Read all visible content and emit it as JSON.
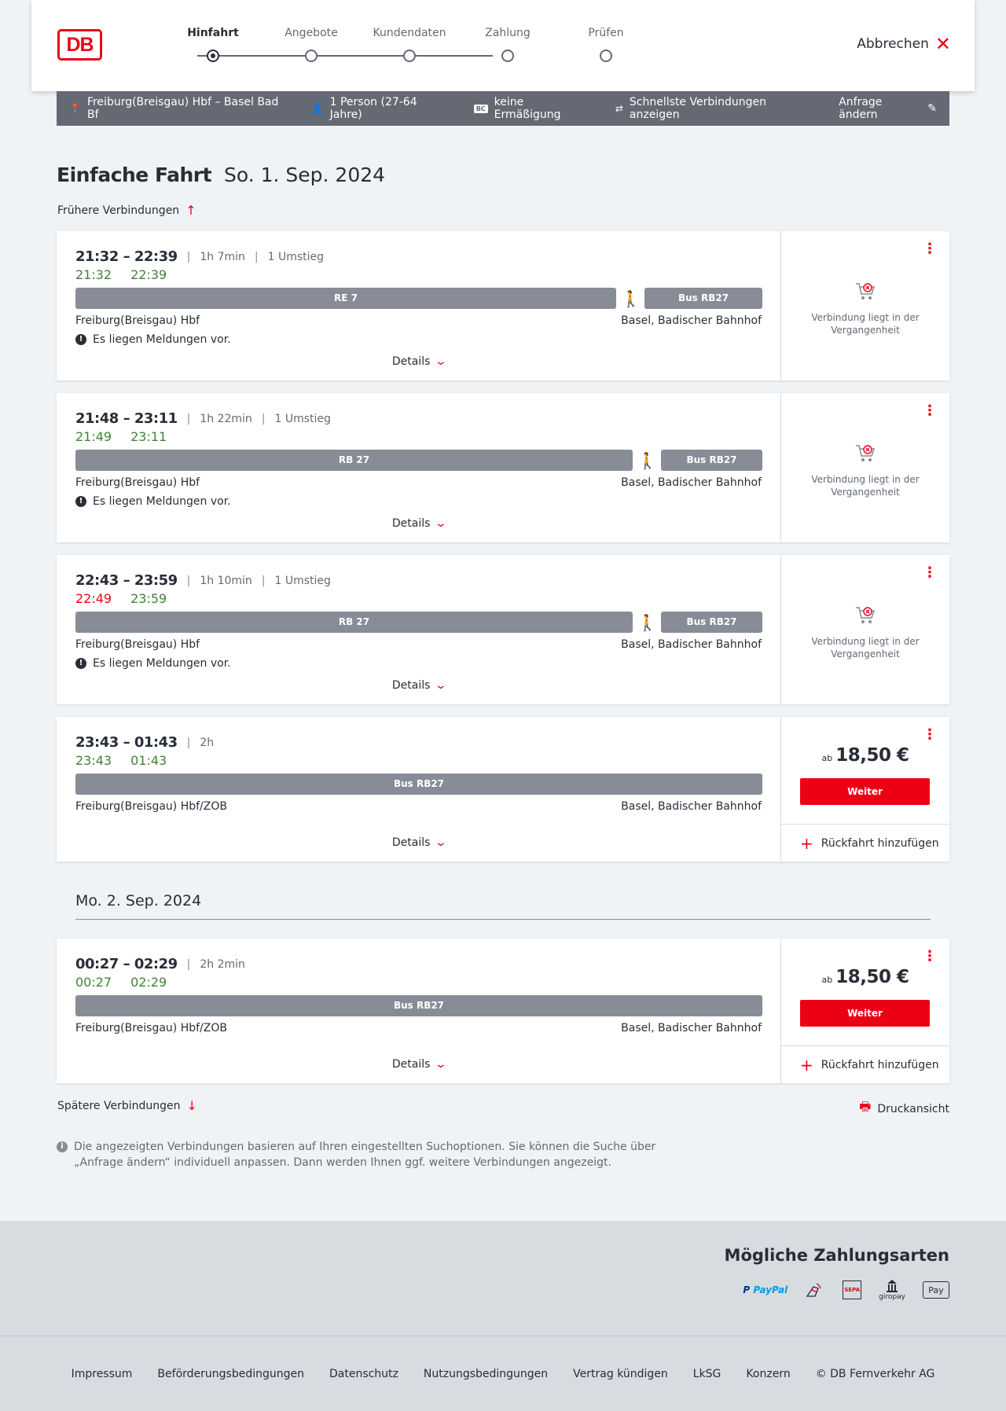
{
  "header": {
    "logo": "DB",
    "steps": [
      {
        "label": "Hinfahrt",
        "active": true
      },
      {
        "label": "Angebote",
        "active": false
      },
      {
        "label": "Kundendaten",
        "active": false
      },
      {
        "label": "Zahlung",
        "active": false
      },
      {
        "label": "Prüfen",
        "active": false
      }
    ],
    "cancel_label": "Abbrechen"
  },
  "infobar": {
    "route": "Freiburg(Breisgau) Hbf – Basel Bad Bf",
    "travellers": "1 Person (27-64 Jahre)",
    "bc_badge": "BC",
    "discount": "keine Ermäßigung",
    "option": "Schnellste Verbindungen anzeigen",
    "edit_label": "Anfrage ändern"
  },
  "title": {
    "trip_type": "Einfache Fahrt",
    "date": "So. 1. Sep. 2024"
  },
  "earlier_label": "Frühere Verbindungen",
  "details_label": "Details",
  "past_label": "Verbindung liegt in der Vergangenheit",
  "price_prefix": "ab",
  "weiter_label": "Weiter",
  "return_label": "Rückfahrt hinzufügen",
  "connections": [
    {
      "times": "21:32 – 22:39",
      "duration": "1h 7min",
      "transfers": "1 Umstieg",
      "rt_dep": "21:32",
      "rt_arr": "22:39",
      "bar1": "RE 7",
      "bar2": "Bus RB27",
      "from": "Freiburg(Breisgau) Hbf",
      "to": "Basel, Badischer Bahnhof",
      "message": "Es liegen Meldungen vor."
    },
    {
      "times": "21:48 – 23:11",
      "duration": "1h 22min",
      "transfers": "1 Umstieg",
      "rt_dep": "21:49",
      "rt_arr": "23:11",
      "bar1": "RB 27",
      "bar2": "Bus RB27",
      "from": "Freiburg(Breisgau) Hbf",
      "to": "Basel, Badischer Bahnhof",
      "message": "Es liegen Meldungen vor."
    },
    {
      "times": "22:43 – 23:59",
      "duration": "1h 10min",
      "transfers": "1 Umstieg",
      "rt_dep": "22:49",
      "rt_arr": "23:59",
      "bar1": "RB 27",
      "bar2": "Bus RB27",
      "from": "Freiburg(Breisgau) Hbf",
      "to": "Basel, Badischer Bahnhof",
      "message": "Es liegen Meldungen vor."
    },
    {
      "times": "23:43 – 01:43",
      "duration": "2h",
      "rt_dep": "23:43",
      "rt_arr": "01:43",
      "bar1": "Bus RB27",
      "from": "Freiburg(Breisgau) Hbf/ZOB",
      "to": "Basel, Badischer Bahnhof",
      "price": "18,50 €"
    },
    {
      "times": "00:27 – 02:29",
      "duration": "2h 2min",
      "rt_dep": "00:27",
      "rt_arr": "02:29",
      "bar1": "Bus RB27",
      "from": "Freiburg(Breisgau) Hbf/ZOB",
      "to": "Basel, Badischer Bahnhof",
      "price": "18,50 €"
    }
  ],
  "day2_label": "Mo. 2. Sep. 2024",
  "later_label": "Spätere Verbindungen",
  "print_label": "Druckansicht",
  "note": "Die angezeigten Verbindungen basieren auf Ihren eingestellten Suchoptionen. Sie können die Suche über „Anfrage ändern“ individuell anpassen. Dann werden Ihnen ggf. weitere Verbindungen angezeigt.",
  "payment": {
    "title": "Mögliche Zahlungsarten",
    "paypal_a": "P",
    "paypal_b": "PayPal",
    "sepa": "SEPA",
    "giropay": "giropay",
    "applepay": "Pay"
  },
  "footer": {
    "links": [
      "Impressum",
      "Beförderungsbedingungen",
      "Datenschutz",
      "Nutzungsbedingungen",
      "Vertrag kündigen",
      "LkSG",
      "Konzern",
      "© DB Fernverkehr AG"
    ]
  },
  "colors": {
    "accent": "#ec0016",
    "ontime": "#408335",
    "bar": "#878c96",
    "infobar": "#646973"
  }
}
